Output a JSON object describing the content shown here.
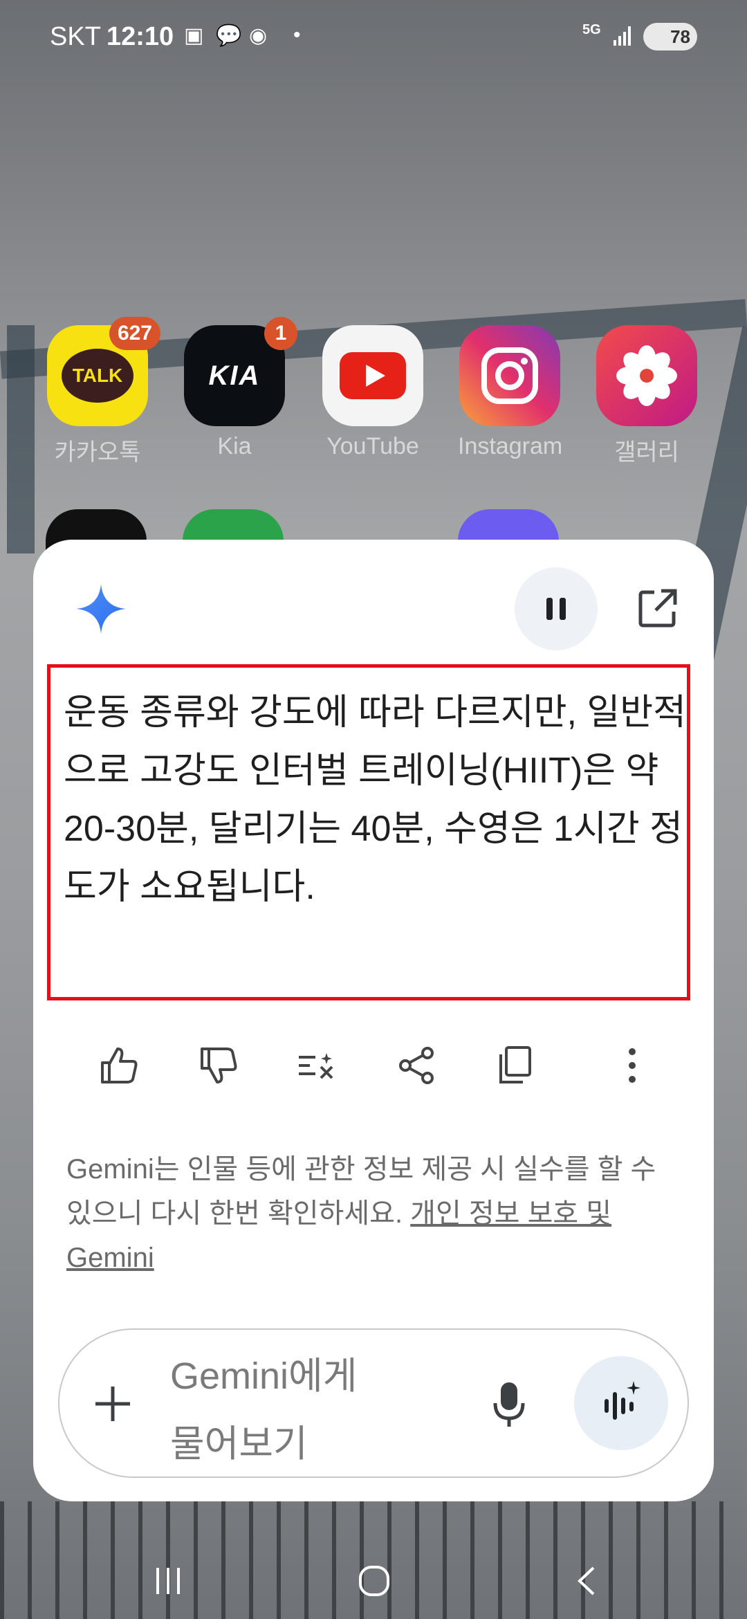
{
  "status_bar": {
    "carrier": "SKT",
    "time": "12:10",
    "notification_icons": [
      "screenshot-icon",
      "talk-icon",
      "location-icon",
      "dot-icon"
    ],
    "network": "5G",
    "battery": "78"
  },
  "home_apps": [
    {
      "label": "카카오톡",
      "badge": "627",
      "icon": "kakaotalk-icon",
      "icon_text": "TALK",
      "color": "#f7e111"
    },
    {
      "label": "Kia",
      "badge": "1",
      "icon": "kia-icon",
      "icon_text": "KIA",
      "color": "#0b0f14"
    },
    {
      "label": "YouTube",
      "badge": "",
      "icon": "youtube-icon",
      "icon_text": "",
      "color": "#f4f4f4"
    },
    {
      "label": "Instagram",
      "badge": "",
      "icon": "instagram-icon",
      "icon_text": "",
      "color": "#d6307f"
    },
    {
      "label": "갤러리",
      "badge": "",
      "icon": "gallery-icon",
      "icon_text": "",
      "color": "#d7286a"
    }
  ],
  "gemini": {
    "answer": "운동 종류와 강도에 따라 다르지만, 일반적으로 고강도 인터벌 트레이닝(HIIT)은 약 20-30분, 달리기는 40분, 수영은 1시간 정도가 소요됩니다.",
    "actions": [
      "thumbs-up-icon",
      "thumbs-down-icon",
      "modify-response-icon",
      "share-icon",
      "copy-icon",
      "more-icon"
    ],
    "disclaimer_text": "Gemini는 인물 등에 관한 정보 제공 시 실수를 할 수 있으니 다시 한번 확인하세요. ",
    "disclaimer_link": "개인 정보 보호 및 Gemini",
    "input_placeholder": "Gemini에게 물어보기"
  },
  "colors": {
    "highlight_border": "#e3101c",
    "gemini_blue": "#4285f4"
  }
}
